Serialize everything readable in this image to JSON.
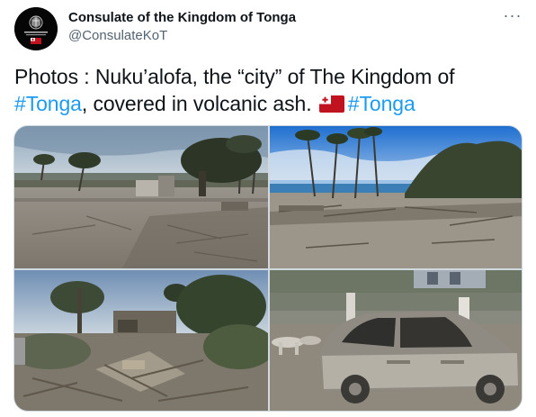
{
  "account": {
    "display_name": "Consulate of the Kingdom of Tonga",
    "handle": "@ConsulateKoT",
    "avatar_icon": "consulate-seal-icon"
  },
  "menu": {
    "more_label": "···"
  },
  "tweet": {
    "text_part1": "Photos : Nuku’alofa, the “city” of The Kingdom of ",
    "hashtag1": "#Tonga",
    "text_part2": ", covered in volcanic ash. ",
    "flag_icon": "tonga-flag-emoji",
    "hashtag2": "#Tonga"
  },
  "colors": {
    "link": "#1d9bf0",
    "text": "#0f1419",
    "secondary": "#536471",
    "border": "#cfd9de"
  },
  "media": {
    "photos": [
      {
        "subject": "ash-covered-street-palms"
      },
      {
        "subject": "ash-covered-shoreline-debris"
      },
      {
        "subject": "collapsed-house-debris"
      },
      {
        "subject": "ash-covered-car"
      }
    ]
  }
}
